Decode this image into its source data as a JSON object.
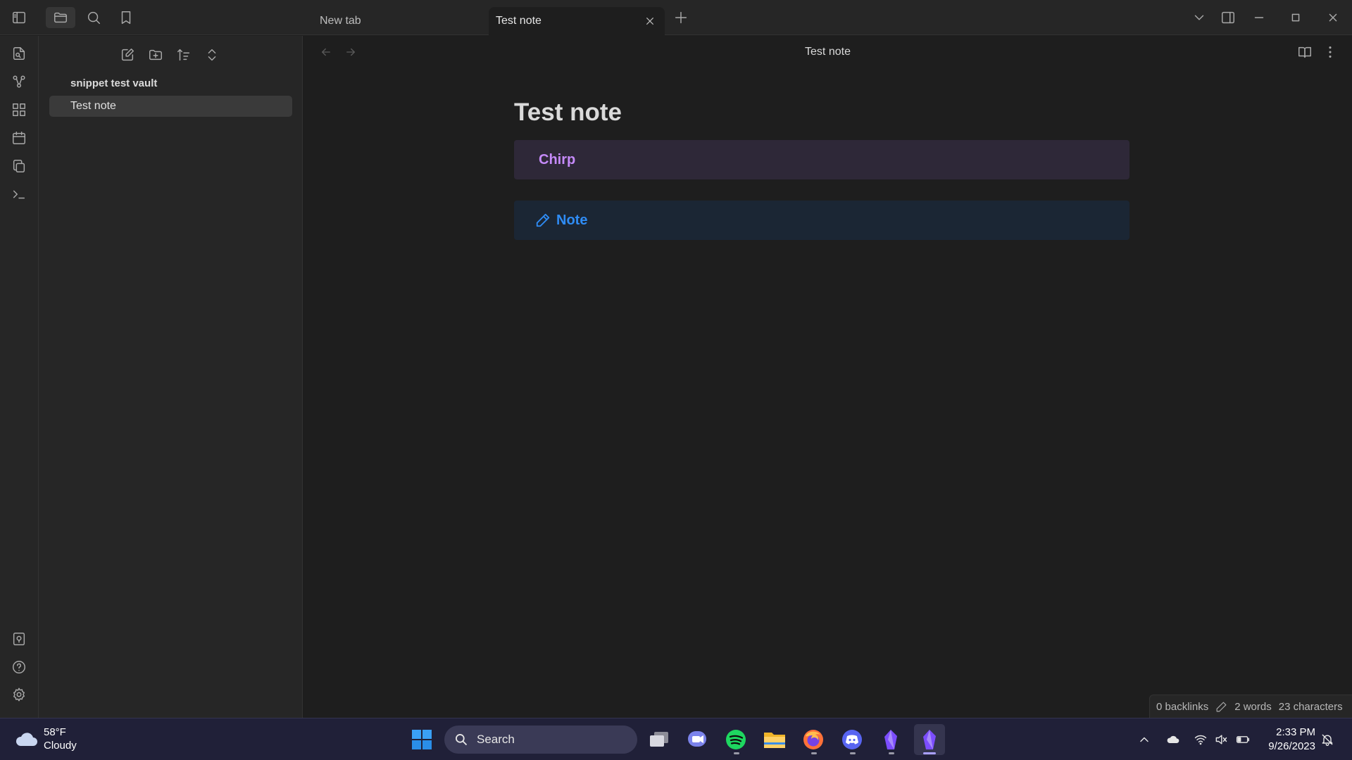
{
  "tabs": [
    {
      "label": "New tab"
    },
    {
      "label": "Test note"
    }
  ],
  "sidebar": {
    "vault_name": "snippet test vault",
    "files": [
      {
        "label": "Test note"
      }
    ]
  },
  "view": {
    "header_title": "Test note"
  },
  "note": {
    "title": "Test note",
    "callouts": [
      {
        "type": "chirp",
        "title": "Chirp",
        "color": "#c58af9"
      },
      {
        "type": "note",
        "title": "Note",
        "color": "#2f8cf5",
        "icon": "pencil-icon"
      }
    ]
  },
  "status": {
    "backlinks": "0 backlinks",
    "words": "2 words",
    "characters": "23 characters"
  },
  "taskbar": {
    "weather_temp": "58°F",
    "weather_desc": "Cloudy",
    "search_placeholder": "Search",
    "time": "2:33 PM",
    "date": "9/26/2023"
  },
  "colors": {
    "background": "#1e1e1e",
    "panel": "#262626",
    "taskbar": "#202038"
  }
}
